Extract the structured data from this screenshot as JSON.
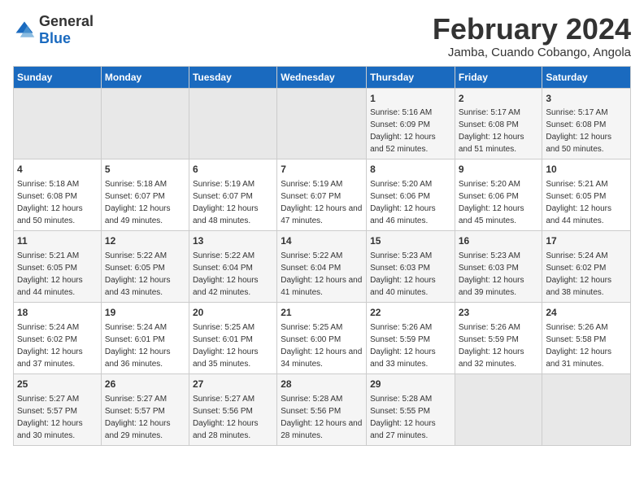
{
  "logo": {
    "general": "General",
    "blue": "Blue"
  },
  "title": "February 2024",
  "subtitle": "Jamba, Cuando Cobango, Angola",
  "days_of_week": [
    "Sunday",
    "Monday",
    "Tuesday",
    "Wednesday",
    "Thursday",
    "Friday",
    "Saturday"
  ],
  "weeks": [
    [
      {
        "day": "",
        "info": ""
      },
      {
        "day": "",
        "info": ""
      },
      {
        "day": "",
        "info": ""
      },
      {
        "day": "",
        "info": ""
      },
      {
        "day": "1",
        "info": "Sunrise: 5:16 AM\nSunset: 6:09 PM\nDaylight: 12 hours and 52 minutes."
      },
      {
        "day": "2",
        "info": "Sunrise: 5:17 AM\nSunset: 6:08 PM\nDaylight: 12 hours and 51 minutes."
      },
      {
        "day": "3",
        "info": "Sunrise: 5:17 AM\nSunset: 6:08 PM\nDaylight: 12 hours and 50 minutes."
      }
    ],
    [
      {
        "day": "4",
        "info": "Sunrise: 5:18 AM\nSunset: 6:08 PM\nDaylight: 12 hours and 50 minutes."
      },
      {
        "day": "5",
        "info": "Sunrise: 5:18 AM\nSunset: 6:07 PM\nDaylight: 12 hours and 49 minutes."
      },
      {
        "day": "6",
        "info": "Sunrise: 5:19 AM\nSunset: 6:07 PM\nDaylight: 12 hours and 48 minutes."
      },
      {
        "day": "7",
        "info": "Sunrise: 5:19 AM\nSunset: 6:07 PM\nDaylight: 12 hours and 47 minutes."
      },
      {
        "day": "8",
        "info": "Sunrise: 5:20 AM\nSunset: 6:06 PM\nDaylight: 12 hours and 46 minutes."
      },
      {
        "day": "9",
        "info": "Sunrise: 5:20 AM\nSunset: 6:06 PM\nDaylight: 12 hours and 45 minutes."
      },
      {
        "day": "10",
        "info": "Sunrise: 5:21 AM\nSunset: 6:05 PM\nDaylight: 12 hours and 44 minutes."
      }
    ],
    [
      {
        "day": "11",
        "info": "Sunrise: 5:21 AM\nSunset: 6:05 PM\nDaylight: 12 hours and 44 minutes."
      },
      {
        "day": "12",
        "info": "Sunrise: 5:22 AM\nSunset: 6:05 PM\nDaylight: 12 hours and 43 minutes."
      },
      {
        "day": "13",
        "info": "Sunrise: 5:22 AM\nSunset: 6:04 PM\nDaylight: 12 hours and 42 minutes."
      },
      {
        "day": "14",
        "info": "Sunrise: 5:22 AM\nSunset: 6:04 PM\nDaylight: 12 hours and 41 minutes."
      },
      {
        "day": "15",
        "info": "Sunrise: 5:23 AM\nSunset: 6:03 PM\nDaylight: 12 hours and 40 minutes."
      },
      {
        "day": "16",
        "info": "Sunrise: 5:23 AM\nSunset: 6:03 PM\nDaylight: 12 hours and 39 minutes."
      },
      {
        "day": "17",
        "info": "Sunrise: 5:24 AM\nSunset: 6:02 PM\nDaylight: 12 hours and 38 minutes."
      }
    ],
    [
      {
        "day": "18",
        "info": "Sunrise: 5:24 AM\nSunset: 6:02 PM\nDaylight: 12 hours and 37 minutes."
      },
      {
        "day": "19",
        "info": "Sunrise: 5:24 AM\nSunset: 6:01 PM\nDaylight: 12 hours and 36 minutes."
      },
      {
        "day": "20",
        "info": "Sunrise: 5:25 AM\nSunset: 6:01 PM\nDaylight: 12 hours and 35 minutes."
      },
      {
        "day": "21",
        "info": "Sunrise: 5:25 AM\nSunset: 6:00 PM\nDaylight: 12 hours and 34 minutes."
      },
      {
        "day": "22",
        "info": "Sunrise: 5:26 AM\nSunset: 5:59 PM\nDaylight: 12 hours and 33 minutes."
      },
      {
        "day": "23",
        "info": "Sunrise: 5:26 AM\nSunset: 5:59 PM\nDaylight: 12 hours and 32 minutes."
      },
      {
        "day": "24",
        "info": "Sunrise: 5:26 AM\nSunset: 5:58 PM\nDaylight: 12 hours and 31 minutes."
      }
    ],
    [
      {
        "day": "25",
        "info": "Sunrise: 5:27 AM\nSunset: 5:57 PM\nDaylight: 12 hours and 30 minutes."
      },
      {
        "day": "26",
        "info": "Sunrise: 5:27 AM\nSunset: 5:57 PM\nDaylight: 12 hours and 29 minutes."
      },
      {
        "day": "27",
        "info": "Sunrise: 5:27 AM\nSunset: 5:56 PM\nDaylight: 12 hours and 28 minutes."
      },
      {
        "day": "28",
        "info": "Sunrise: 5:28 AM\nSunset: 5:56 PM\nDaylight: 12 hours and 28 minutes."
      },
      {
        "day": "29",
        "info": "Sunrise: 5:28 AM\nSunset: 5:55 PM\nDaylight: 12 hours and 27 minutes."
      },
      {
        "day": "",
        "info": ""
      },
      {
        "day": "",
        "info": ""
      }
    ]
  ]
}
